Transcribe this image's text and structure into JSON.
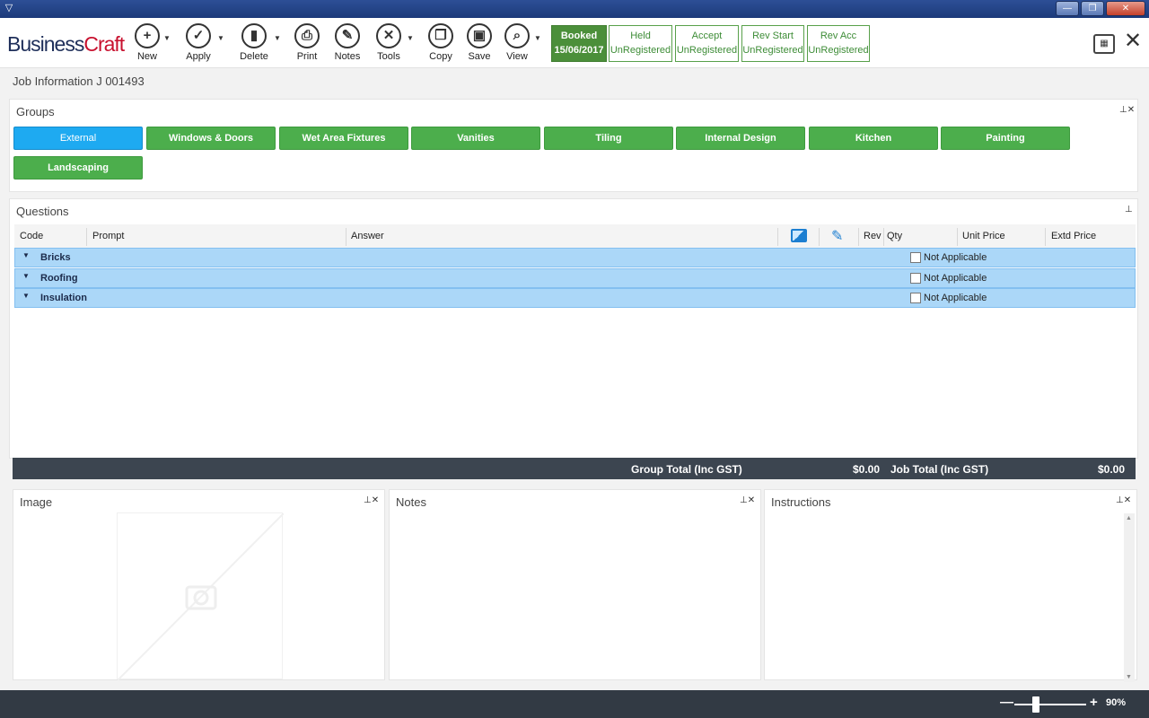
{
  "window": {
    "app_icon": "app-logo-icon",
    "minimize": "—",
    "maximize": "❐",
    "close": "✕"
  },
  "toolbar": {
    "logo_business": "Business",
    "logo_craft": "Craft",
    "buttons": [
      {
        "label": "New",
        "icon": "plus-icon",
        "glyph": "+"
      },
      {
        "label": "Apply",
        "icon": "check-icon",
        "glyph": "✓"
      },
      {
        "label": "Delete",
        "icon": "trash-icon",
        "glyph": "▮"
      },
      {
        "label": "Print",
        "icon": "printer-icon",
        "glyph": "⎙"
      },
      {
        "label": "Notes",
        "icon": "notes-icon",
        "glyph": "✎"
      },
      {
        "label": "Tools",
        "icon": "tools-icon",
        "glyph": "✕"
      },
      {
        "label": "Copy",
        "icon": "copy-icon",
        "glyph": "❐"
      },
      {
        "label": "Save",
        "icon": "save-icon",
        "glyph": "▣"
      },
      {
        "label": "View",
        "icon": "magnifier-icon",
        "glyph": "⌕"
      }
    ],
    "statuses": [
      {
        "line1": "Booked",
        "line2": "15/06/2017"
      },
      {
        "line1": "Held",
        "line2": "UnRegistered"
      },
      {
        "line1": "Accept",
        "line2": "UnRegistered"
      },
      {
        "line1": "Rev Start",
        "line2": "UnRegistered"
      },
      {
        "line1": "Rev Acc",
        "line2": "UnRegistered"
      }
    ],
    "calendar_icon": "calendar-icon",
    "close_glyph": "✕"
  },
  "job_info": "Job Information J 001493",
  "groups": {
    "title": "Groups",
    "pin": "⊥✕",
    "items": [
      "External",
      "Windows & Doors",
      "Wet Area Fixtures",
      "Vanities",
      "Tiling",
      "Internal Design",
      "Kitchen",
      "Painting",
      "Landscaping"
    ],
    "selected": "External"
  },
  "questions": {
    "title": "Questions",
    "pin": "⊥",
    "columns": {
      "code": "Code",
      "prompt": "Prompt",
      "answer": "Answer",
      "image_icon": "image-icon",
      "edit_icon": "edit-icon",
      "rev": "Rev",
      "qty": "Qty",
      "unit_price": "Unit Price",
      "extd_price": "Extd Price"
    },
    "rows": [
      {
        "code": "Bricks",
        "na_label": "Not Applicable",
        "na_checked": false
      },
      {
        "code": "Roofing",
        "na_label": "Not Applicable",
        "na_checked": false
      },
      {
        "code": "Insulation",
        "na_label": "Not Applicable",
        "na_checked": false
      }
    ]
  },
  "totals": {
    "group_label": "Group Total (Inc GST)",
    "group_value": "$0.00",
    "job_label": "Job Total (Inc GST)",
    "job_value": "$0.00"
  },
  "image_panel": {
    "title": "Image",
    "pin": "⊥✕"
  },
  "notes_panel": {
    "title": "Notes",
    "pin": "⊥✕"
  },
  "instructions_panel": {
    "title": "Instructions",
    "pin": "⊥✕"
  },
  "zoom": {
    "minus": "—",
    "plus": "+",
    "value": "90%",
    "level_percent": 90
  }
}
